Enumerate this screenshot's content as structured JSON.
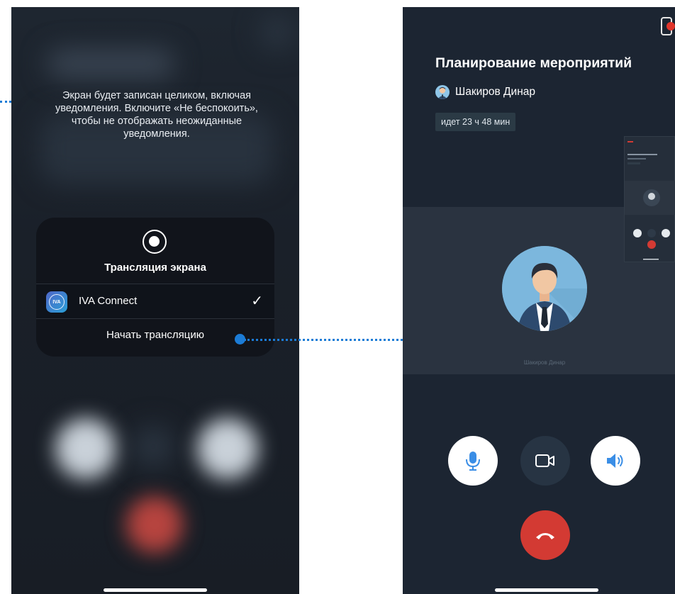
{
  "left_screen": {
    "notice": "Экран будет записан целиком, включая уведомления. Включите «Не беспокоить», чтобы не отображать неожиданные уведомления.",
    "sheet_title": "Трансляция экрана",
    "app_name": "IVA Connect",
    "app_icon_text": "IVA",
    "check_glyph": "✓",
    "start_button": "Начать трансляцию"
  },
  "right_screen": {
    "meeting_title": "Планирование мероприятий",
    "host_name": "Шакиров Динар",
    "duration": "идет 23 ч 48 мин",
    "participant_label": "Шакиров Динар",
    "controls": {
      "mic": "microphone-icon",
      "camera": "video-camera-icon",
      "speaker": "speaker-icon",
      "hangup": "hang-up-icon"
    }
  },
  "colors": {
    "accent": "#1c7cd6",
    "hangup": "#d33a33",
    "mic_blue": "#3a8ee6",
    "background_dark": "#1c2532"
  }
}
